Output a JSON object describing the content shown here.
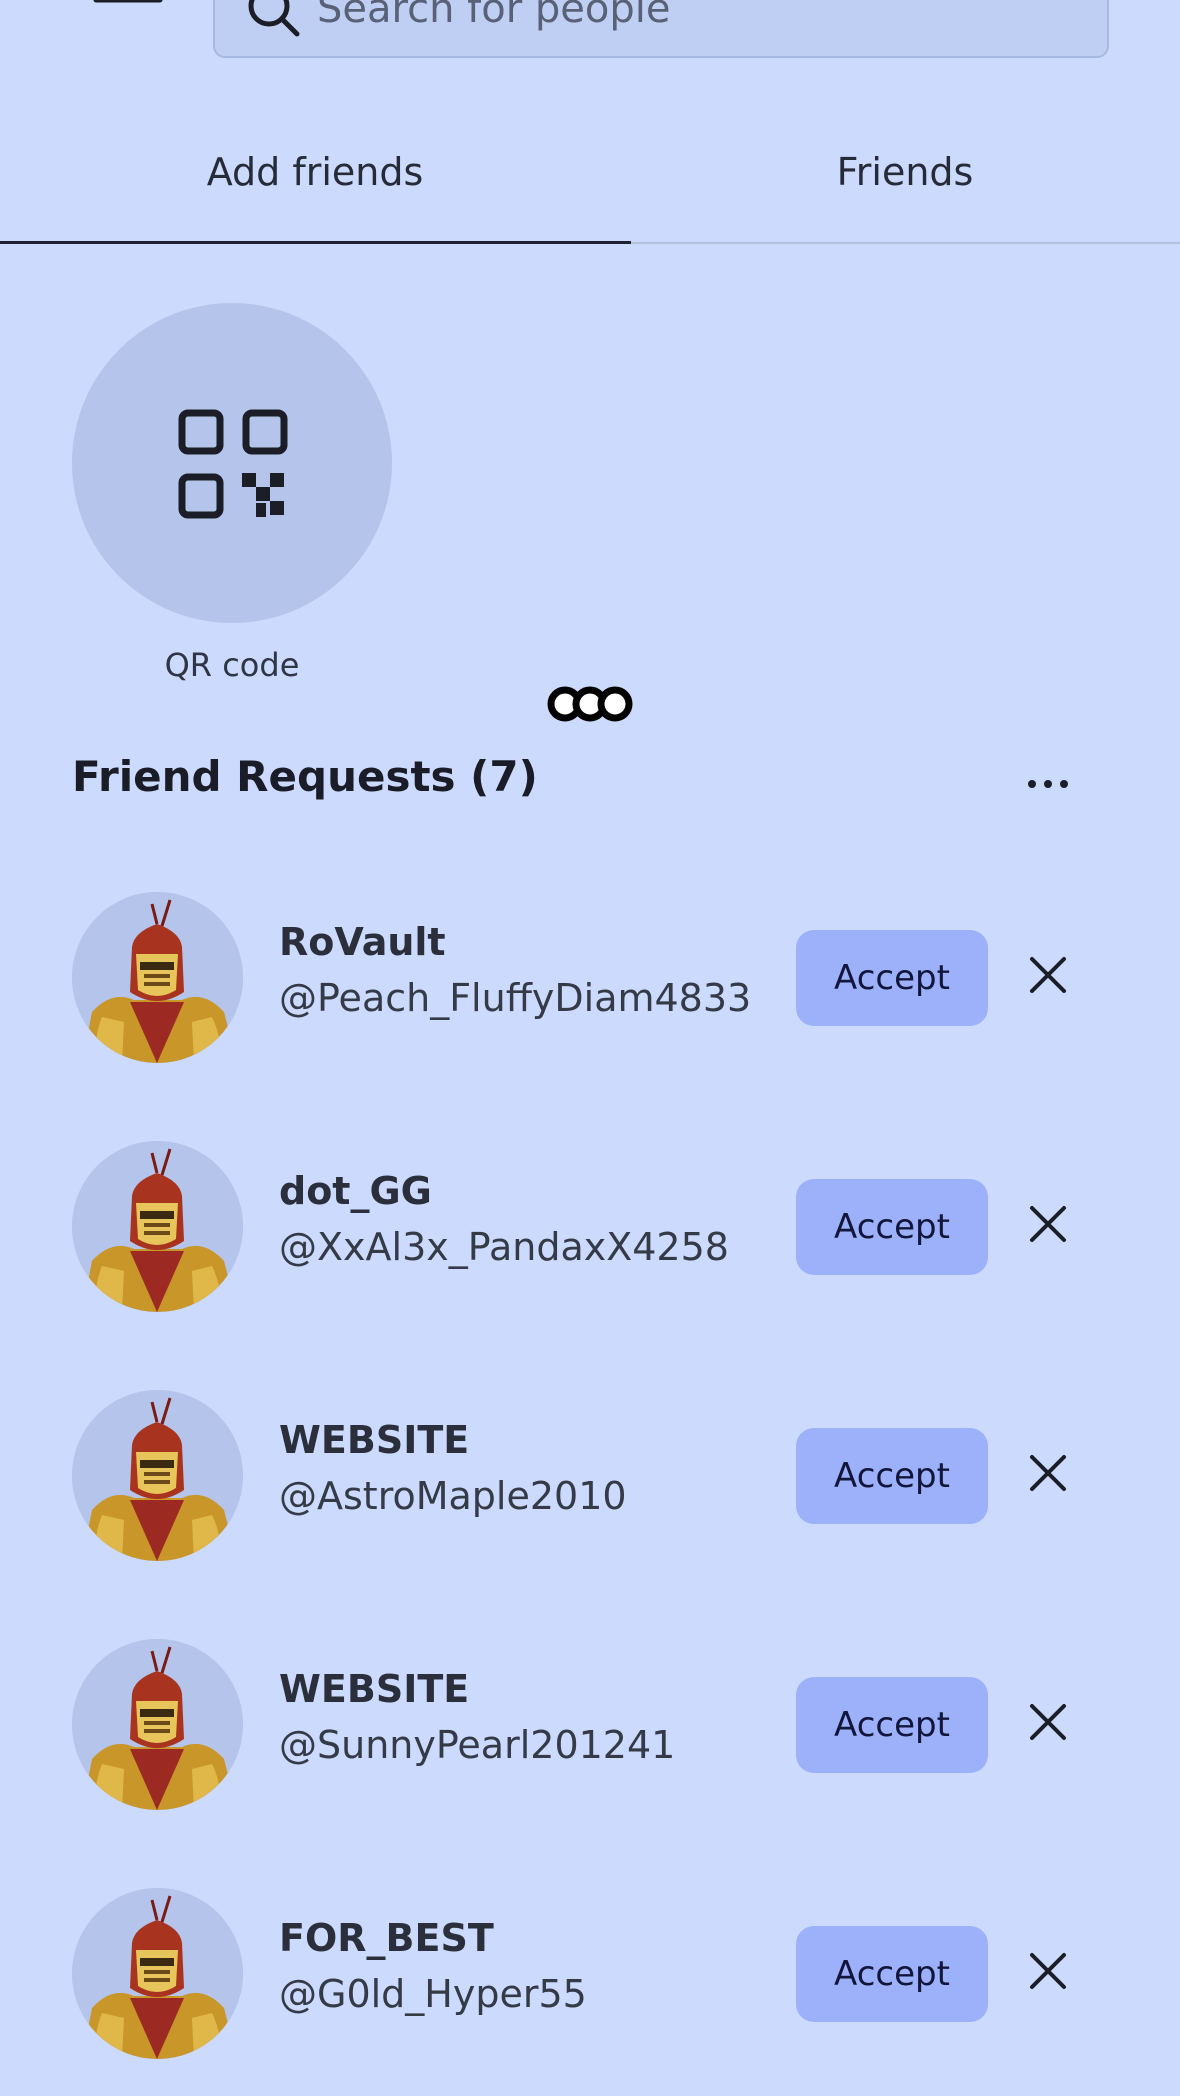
{
  "search": {
    "placeholder": "Search for people"
  },
  "tabs": [
    {
      "label": "Add friends",
      "active": true
    },
    {
      "label": "Friends",
      "active": false
    }
  ],
  "qr": {
    "label": "QR code",
    "icon": "qr-code-icon"
  },
  "requests": {
    "title": "Friend Requests (7)",
    "accept_label": "Accept",
    "items": [
      {
        "name": "RoVault",
        "handle": "@Peach_FluffyDiam4833"
      },
      {
        "name": "dot_GG",
        "handle": "@XxAl3x_PandaxX4258"
      },
      {
        "name": "WEBSITE",
        "handle": "@AstroMaple2010"
      },
      {
        "name": "WEBSITE",
        "handle": "@SunnyPearl201241"
      },
      {
        "name": "FOR_BEST",
        "handle": "@G0ld_Hyper55"
      }
    ]
  },
  "colors": {
    "background": "#cbdafd",
    "accent_button": "#9db1fb",
    "avatar_bg": "#b4c4ea"
  }
}
